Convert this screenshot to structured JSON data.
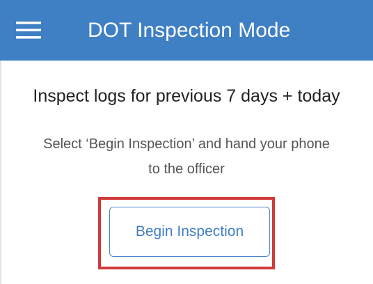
{
  "header": {
    "title": "DOT Inspection Mode",
    "background_color": "#3f7fc4",
    "menu_icon": "hamburger-menu-icon"
  },
  "main": {
    "headline": "Inspect logs for previous 7 days + today",
    "instructions": "Select ‘Begin Inspection’ and hand your phone to the officer",
    "begin_button_label": "Begin Inspection",
    "accent_color": "#3f7fc4",
    "highlight_color": "#d03a3a"
  }
}
